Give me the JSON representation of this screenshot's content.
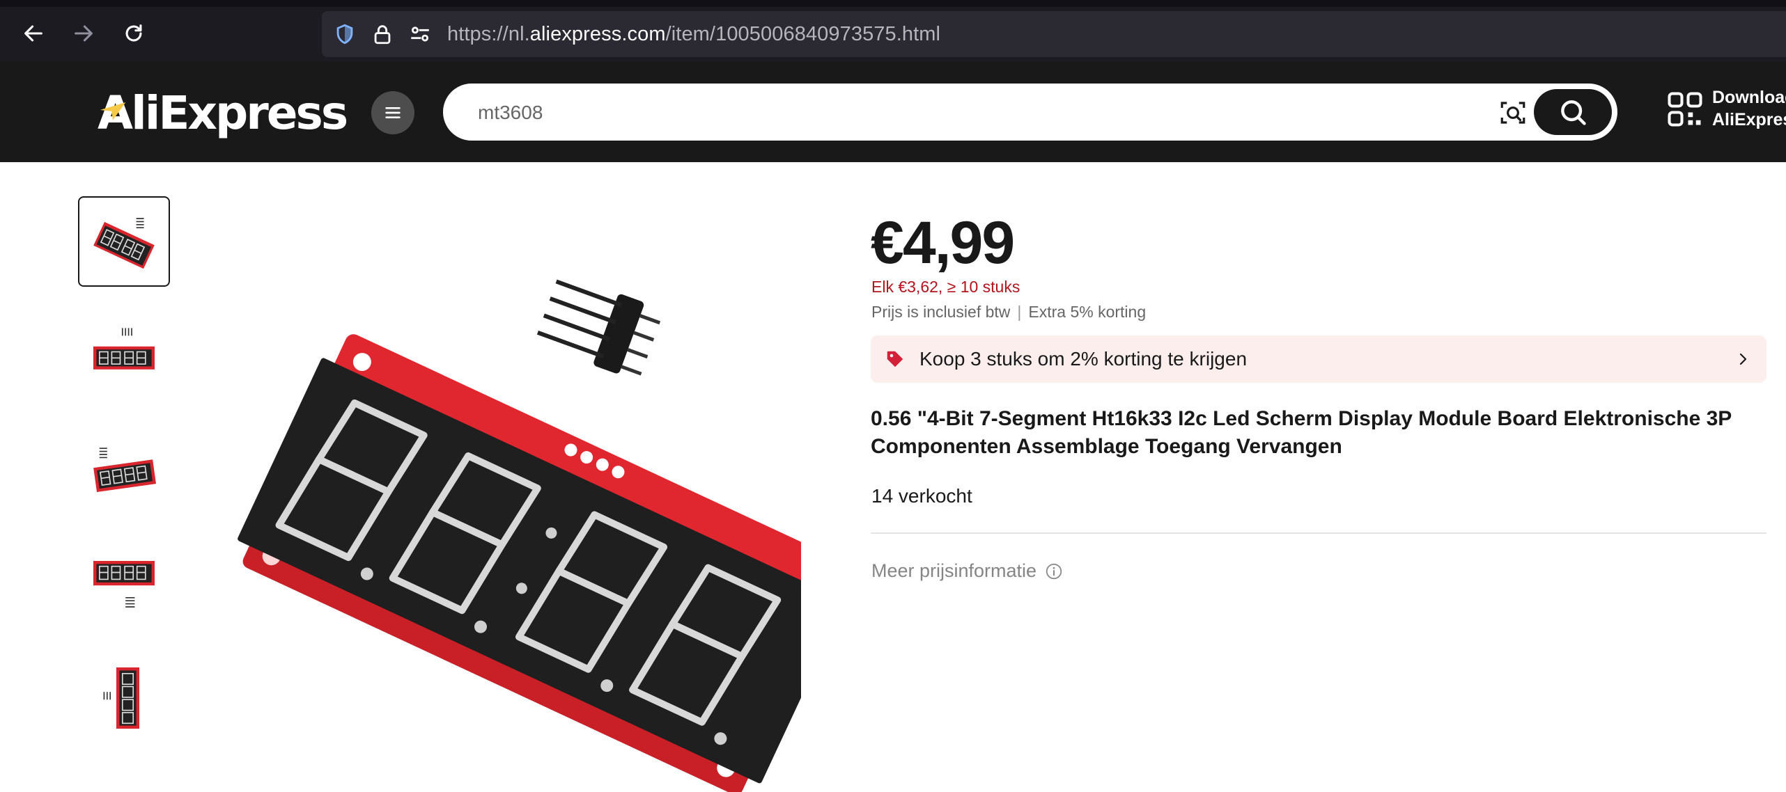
{
  "browser": {
    "url_prefix": "https://nl.",
    "url_host": "aliexpress.com",
    "url_path": "/item/1005006840973575.html",
    "icons": [
      "back-arrow-icon",
      "forward-arrow-icon",
      "reload-icon",
      "shield-icon",
      "lock-icon",
      "permissions-icon"
    ]
  },
  "header": {
    "logo": "AliExpress",
    "search_value": "mt3608",
    "download_line1": "Download",
    "download_line2": "AliExpress",
    "colors": {
      "background": "#191919",
      "logo_accent": "#f7c948"
    }
  },
  "gallery": {
    "thumbnails": [
      {
        "label": "product-angle-1",
        "active": true
      },
      {
        "label": "product-front"
      },
      {
        "label": "product-angle-2"
      },
      {
        "label": "product-front-pins-below"
      },
      {
        "label": "product-vertical"
      }
    ]
  },
  "product": {
    "price": "€4,99",
    "bulk_price": "Elk €3,62, ≥ 10 stuks",
    "tax_note": "Prijs is inclusief btw",
    "extra_discount": "Extra 5% korting",
    "promo_text": "Koop 3 stuks om 2% korting te krijgen",
    "title": "0.56 \"4-Bit 7-Segment Ht16k33 I2c Led Scherm Display Module Board Elektronische 3P Componenten Assemblage Toegang Vervangen",
    "sold": "14 verkocht",
    "more_price_info": "Meer prijsinformatie",
    "colors": {
      "bulk_price": "#b3141d",
      "promo_bg": "#fdeeee",
      "promo_tag": "#d3213a"
    }
  }
}
